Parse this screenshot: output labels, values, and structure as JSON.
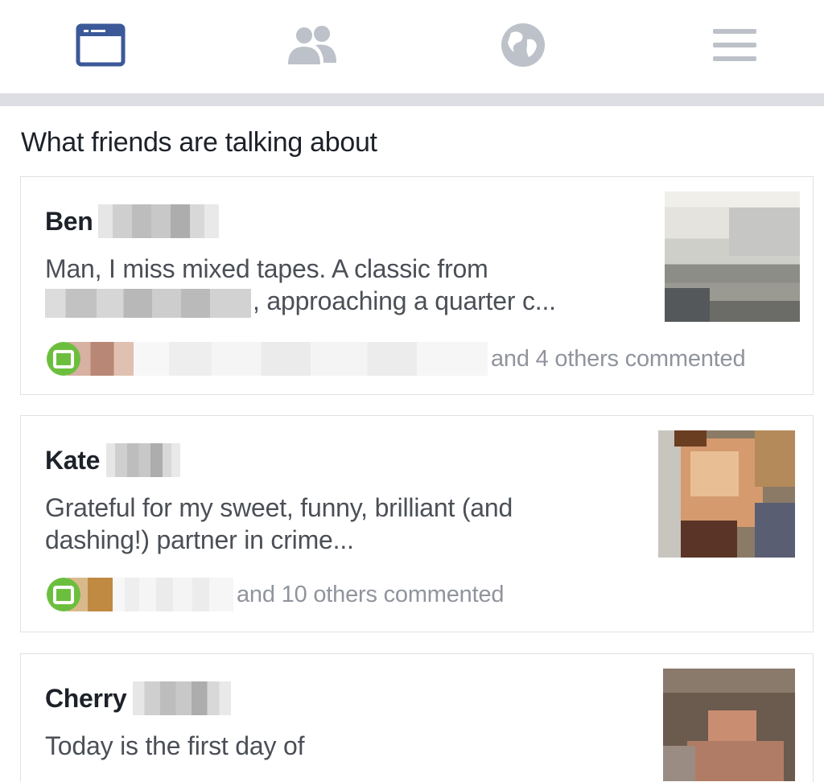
{
  "nav": {
    "items": [
      {
        "name": "news-feed",
        "icon": "news-feed-icon",
        "active": true
      },
      {
        "name": "friends",
        "icon": "friends-icon",
        "active": false
      },
      {
        "name": "notifications",
        "icon": "globe-icon",
        "active": false
      },
      {
        "name": "menu",
        "icon": "hamburger-menu-icon",
        "active": false
      }
    ],
    "active_color": "#3b5998",
    "inactive_color": "#bdc1c9"
  },
  "section": {
    "title": "What friends are talking about"
  },
  "posts": [
    {
      "author": "Ben",
      "text_line1": "Man, I miss mixed tapes. A classic from",
      "text_line2": ", approaching a quarter c...",
      "comment_summary": "and 4 others commented"
    },
    {
      "author": "Kate",
      "text_line1": "Grateful for my sweet, funny, brilliant (and",
      "text_line2": "dashing!) partner in crime...",
      "comment_summary": "and 10 others commented"
    },
    {
      "author": "Cherry",
      "text_line1": "Today is the first day of",
      "text_line2": "",
      "comment_summary": ""
    }
  ],
  "colors": {
    "comment_icon": "#6cbf3e",
    "secondary_text": "#90949c",
    "body_text": "#4b4f56"
  }
}
